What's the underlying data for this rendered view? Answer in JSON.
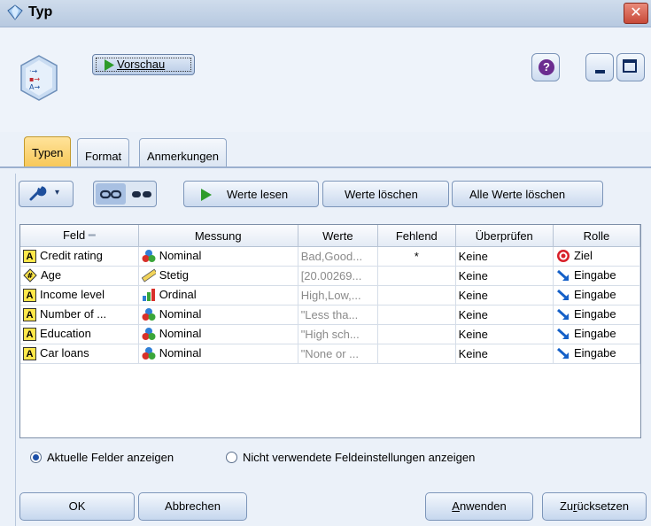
{
  "window": {
    "title": "Typ"
  },
  "toolbar": {
    "preview_label": "Vorschau"
  },
  "tabs": [
    {
      "label": "Typen",
      "active": true
    },
    {
      "label": "Format",
      "active": false
    },
    {
      "label": "Anmerkungen",
      "active": false
    }
  ],
  "actions": {
    "read_values": "Werte lesen",
    "clear_values": "Werte löschen",
    "clear_all_values": "Alle Werte löschen"
  },
  "table": {
    "columns": [
      "Feld",
      "Messung",
      "Werte",
      "Fehlend",
      "Überprüfen",
      "Rolle"
    ],
    "rows": [
      {
        "feld": "Credit rating",
        "feld_icon": "string-icon",
        "messung": "Nominal",
        "messung_icon": "nominal-icon",
        "werte": "Bad,Good...",
        "fehlend": "*",
        "ueberpruefen": "Keine",
        "rolle": "Ziel",
        "rolle_icon": "target-icon"
      },
      {
        "feld": "Age",
        "feld_icon": "numeric-icon",
        "messung": "Stetig",
        "messung_icon": "continuous-icon",
        "werte": "[20.00269...",
        "fehlend": "",
        "ueberpruefen": "Keine",
        "rolle": "Eingabe",
        "rolle_icon": "input-arrow-icon"
      },
      {
        "feld": "Income level",
        "feld_icon": "string-icon",
        "messung": "Ordinal",
        "messung_icon": "ordinal-icon",
        "werte": "High,Low,...",
        "fehlend": "",
        "ueberpruefen": "Keine",
        "rolle": "Eingabe",
        "rolle_icon": "input-arrow-icon"
      },
      {
        "feld": "Number of ...",
        "feld_icon": "string-icon",
        "messung": "Nominal",
        "messung_icon": "nominal-icon",
        "werte": "\"Less tha...",
        "fehlend": "",
        "ueberpruefen": "Keine",
        "rolle": "Eingabe",
        "rolle_icon": "input-arrow-icon"
      },
      {
        "feld": "Education",
        "feld_icon": "string-icon",
        "messung": "Nominal",
        "messung_icon": "nominal-icon",
        "werte": "\"High sch...",
        "fehlend": "",
        "ueberpruefen": "Keine",
        "rolle": "Eingabe",
        "rolle_icon": "input-arrow-icon"
      },
      {
        "feld": "Car loans",
        "feld_icon": "string-icon",
        "messung": "Nominal",
        "messung_icon": "nominal-icon",
        "werte": "\"None or ...",
        "fehlend": "",
        "ueberpruefen": "Keine",
        "rolle": "Eingabe",
        "rolle_icon": "input-arrow-icon"
      }
    ]
  },
  "radios": {
    "current_fields": "Aktuelle Felder anzeigen",
    "unused_settings": "Nicht verwendete Feldeinstellungen anzeigen",
    "selected": "current_fields"
  },
  "buttons": {
    "ok": "OK",
    "cancel": "Abbrechen",
    "apply": "Anwenden",
    "reset": "Zurücksetzen"
  },
  "colors": {
    "active_tab": "#f7c85a",
    "accent": "#1b4fa8",
    "target": "#d8202a",
    "input_arrow": "#1560c8"
  }
}
